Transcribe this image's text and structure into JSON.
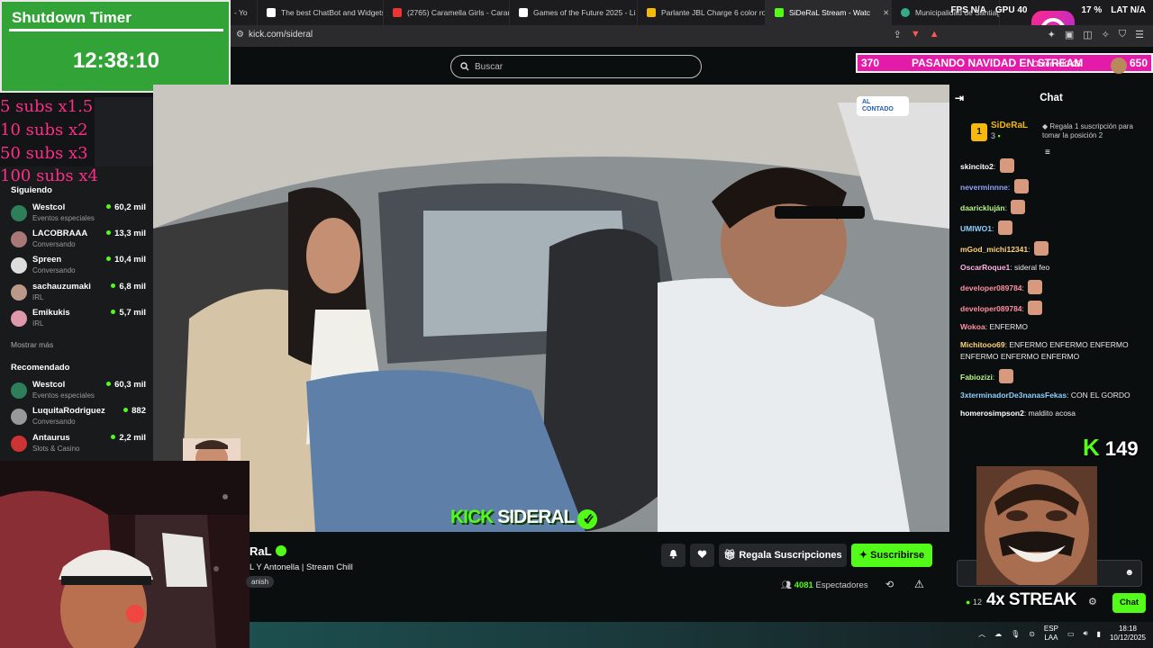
{
  "browser": {
    "tabs": [
      {
        "label": "- Yo",
        "color": "#e33"
      },
      {
        "label": "The best ChatBot and Widgets",
        "color": "#fff"
      },
      {
        "label": "(2765) Caramella Girls - Caram",
        "color": "#e33"
      },
      {
        "label": "Games of the Future 2025 - Li",
        "color": "#fff"
      },
      {
        "label": "Parlante JBL Charge 6 color ro",
        "color": "#f5b80d"
      },
      {
        "label": "SiDeRaL Stream - Watc",
        "color": "#53fc18",
        "active": true
      },
      {
        "label": "Municipalidad de Santiago d",
        "color": "#3a8"
      }
    ],
    "url": "kick.com/sideral",
    "stats": {
      "fps_label": "FPS",
      "fps_value": "N/A",
      "gpu_label": "GPU",
      "gpu_value": "40",
      "cpu_value": "17 %",
      "lat_label": "LAT",
      "lat_value": "N/A"
    }
  },
  "overlay": {
    "timer_title": "Shutdown Timer",
    "timer_value": "12:38:10",
    "subs_lines": [
      "5 subs x1.5",
      "10 subs x2",
      "50 subs x3",
      "100 subs x4"
    ],
    "banner_left": "370",
    "banner_middle": "PASANDO NAVIDAD EN STREAM",
    "banner_right": "650",
    "kicks_label": "Obtén KICKS",
    "kick_counter": "149",
    "streak": "4x STREAK"
  },
  "header": {
    "search_placeholder": "Buscar"
  },
  "sidebar": {
    "following_title": "Siguiendo",
    "following": [
      {
        "name": "Westcol",
        "category": "Eventos especiales",
        "viewers": "60,2 mil",
        "color": "#2e7d5b"
      },
      {
        "name": "LACOBRAAA",
        "category": "Conversando",
        "viewers": "13,3 mil",
        "color": "#a77"
      },
      {
        "name": "Spreen",
        "category": "Conversando",
        "viewers": "10,4 mil",
        "color": "#ddd"
      },
      {
        "name": "sachauzumaki",
        "category": "IRL",
        "viewers": "6,8 mil",
        "color": "#b98"
      },
      {
        "name": "Emikukis",
        "category": "IRL",
        "viewers": "5,7 mil",
        "color": "#d9a"
      }
    ],
    "show_more": "Mostrar más",
    "recommended_title": "Recomendado",
    "recommended": [
      {
        "name": "Westcol",
        "category": "Eventos especiales",
        "viewers": "60,3 mil",
        "color": "#2e7d5b"
      },
      {
        "name": "LuquitaRodriguez",
        "category": "Conversando",
        "viewers": "882",
        "color": "#999"
      },
      {
        "name": "Antaurus",
        "category": "Slots & Casino",
        "viewers": "2,2 mil",
        "color": "#c33"
      }
    ]
  },
  "video": {
    "logo_left": "KICK",
    "logo_right": "SIDERAL",
    "badge": "AL CONTADO"
  },
  "stream": {
    "name": "RaL",
    "title": "L Y Antonella | Stream Chill",
    "tag": "anish",
    "gift_label": "Regala Suscripciones",
    "subscribe_label": "Suscribirse",
    "viewers_count": "4081",
    "viewers_label": "Espectadores"
  },
  "chat": {
    "title": "Chat",
    "pinned": {
      "rank": "1",
      "name": "SiDeRaL",
      "sub_count": "3",
      "note": "Regala 1 suscripción para tomar la posición 2"
    },
    "messages": [
      {
        "user": "skincito2",
        "text": "",
        "emote": true,
        "color": "#fff"
      },
      {
        "user": "neverminnne",
        "text": "",
        "emote": true,
        "color": "#8fa2ff"
      },
      {
        "user": "daarickluján",
        "text": "",
        "emote": true,
        "color": "#b6f58a"
      },
      {
        "user": "UMIWO1",
        "text": "",
        "emote": true,
        "color": "#8fd0ff"
      },
      {
        "user": "mGod_michi12341",
        "text": "",
        "emote": true,
        "color": "#ffd37a"
      },
      {
        "user": "OscarRoque1",
        "text": "sideral feo",
        "emote": false,
        "color": "#ffb0e0"
      },
      {
        "user": "developer089784",
        "text": "",
        "emote": true,
        "color": "#ff8fa2"
      },
      {
        "user": "developer089784",
        "text": "",
        "emote": true,
        "color": "#ff8fa2"
      },
      {
        "user": "Wokoa",
        "text": "ENFERMO",
        "emote": false,
        "color": "#ff8fa2"
      },
      {
        "user": "Michitooo69",
        "text": "ENFERMO ENFERMO ENFERMO ENFERMO ENFERMO ENFERMO",
        "emote": false,
        "color": "#ffd37a"
      },
      {
        "user": "Fabiozizi",
        "text": "",
        "emote": true,
        "color": "#b6f58a"
      },
      {
        "user": "3xterminadorDe3nanasFekas",
        "text": "CON EL GORDO",
        "emote": false,
        "color": "#8fd0ff"
      },
      {
        "user": "homerosimpson2",
        "text": "maldito acosa",
        "emote": false,
        "color": "#fff"
      }
    ],
    "send_label": "Chat",
    "points": "12"
  },
  "taskbar": {
    "lang_top": "ESP",
    "lang_bottom": "LAA",
    "time": "18:18",
    "date": "10/12/2025"
  }
}
